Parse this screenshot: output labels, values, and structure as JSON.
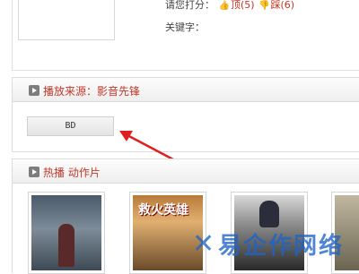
{
  "rating": {
    "label": "请您打分：",
    "up_label": "顶",
    "up_count": "(5)",
    "down_label": "踩",
    "down_count": "(6)",
    "up_icon": "thumb-up-icon",
    "down_icon": "thumb-down-icon"
  },
  "keywords": {
    "label": "关键字："
  },
  "source_section": {
    "title": "播放来源：影音先锋",
    "button_label": "BD"
  },
  "hot_section": {
    "title": "热播  动作片"
  },
  "posters": [
    {
      "title": ""
    },
    {
      "title": "救火英雄"
    },
    {
      "title": ""
    },
    {
      "title": ""
    }
  ],
  "watermark": {
    "text": "易企作网络"
  },
  "colors": {
    "accent": "#c0392b",
    "watermark": "#1e64c8",
    "arrow": "#e02020"
  }
}
